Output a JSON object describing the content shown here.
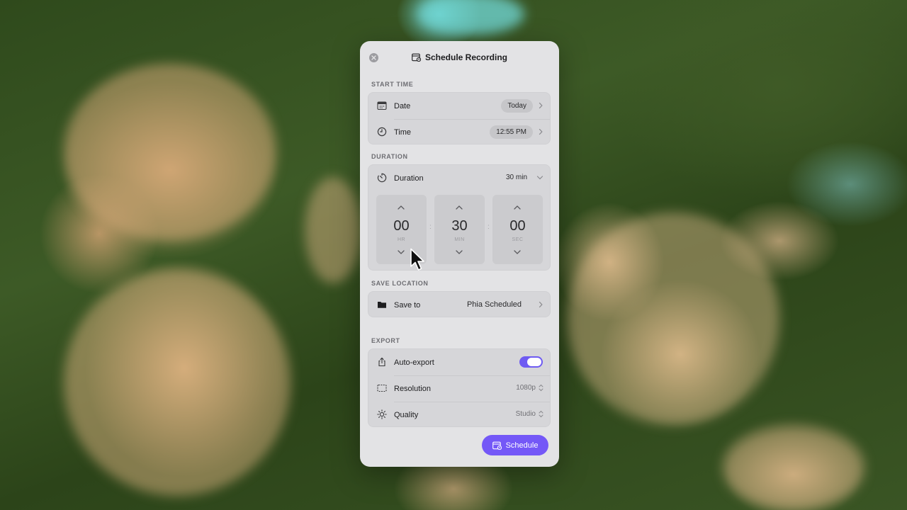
{
  "window": {
    "title": "Schedule Recording"
  },
  "start_time": {
    "section_label": "START TIME",
    "date": {
      "label": "Date",
      "value": "Today"
    },
    "time": {
      "label": "Time",
      "value": "12:55 PM"
    }
  },
  "duration": {
    "section_label": "DURATION",
    "label": "Duration",
    "value": "30 min",
    "spinners": [
      {
        "value": "00",
        "unit": "HR"
      },
      {
        "value": "30",
        "unit": "MIN"
      },
      {
        "value": "00",
        "unit": "SEC"
      }
    ],
    "separator": ":"
  },
  "save_location": {
    "section_label": "SAVE LOCATION",
    "label": "Save to",
    "value": "Phia Scheduled"
  },
  "export": {
    "section_label": "EXPORT",
    "auto_export": {
      "label": "Auto-export",
      "enabled": true
    },
    "resolution": {
      "label": "Resolution",
      "value": "1080p"
    },
    "quality": {
      "label": "Quality",
      "value": "Studio"
    }
  },
  "actions": {
    "schedule_label": "Schedule"
  },
  "colors": {
    "accent": "#7458f7",
    "toggle_on": "#6e5bf2",
    "panel_bg": "#e3e3e5"
  },
  "icons": {
    "close": "close-icon",
    "title": "calendar-clock-icon",
    "date": "calendar-icon",
    "time": "clock-icon",
    "duration": "timer-icon",
    "save_to": "folder-icon",
    "auto_export": "share-icon",
    "resolution": "resolution-frame-icon",
    "quality": "sun-icon",
    "schedule": "calendar-clock-icon",
    "cursor": "mouse-pointer-icon"
  }
}
